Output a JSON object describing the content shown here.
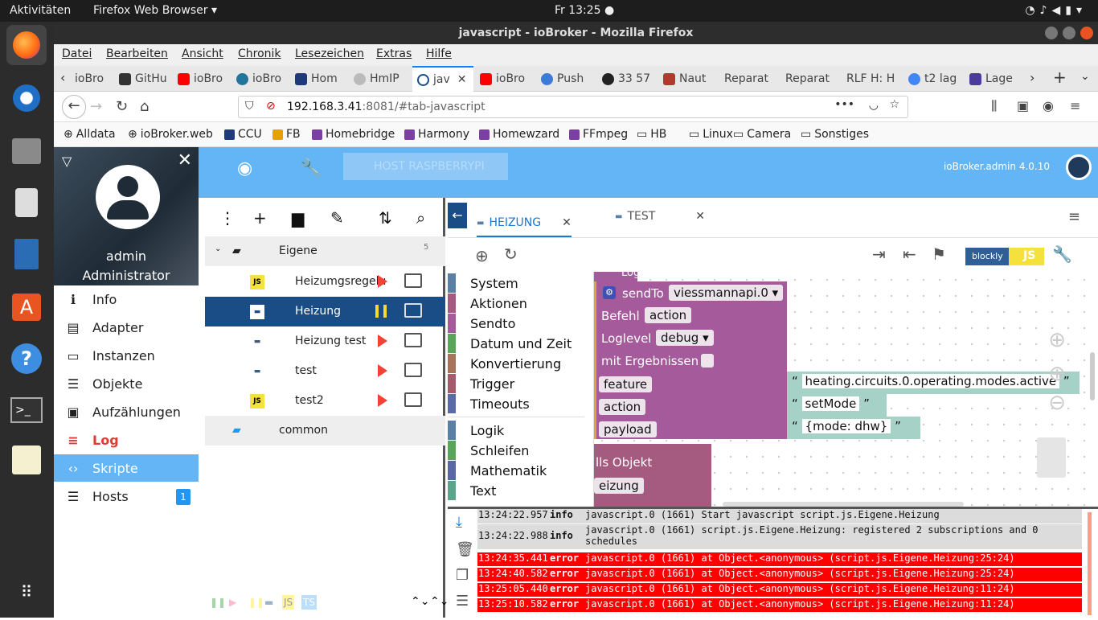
{
  "ubuntu": {
    "activities": "Aktivitäten",
    "app": "Firefox Web Browser ▾",
    "clock": "Fr 13:25 ●"
  },
  "window": {
    "title": "javascript - ioBroker - Mozilla Firefox"
  },
  "menu": [
    "Datei",
    "Bearbeiten",
    "Ansicht",
    "Chronik",
    "Lesezeichen",
    "Extras",
    "Hilfe"
  ],
  "tabs": [
    {
      "label": "ioBro",
      "color": "#4a8fd8"
    },
    {
      "label": "GitHu",
      "color": "#333333"
    },
    {
      "label": "ioBro",
      "color": "#ff0000"
    },
    {
      "label": "ioBro",
      "color": "#21759b"
    },
    {
      "label": "Hom",
      "color": "#1e3a78"
    },
    {
      "label": "HmIP",
      "color": "#bbbbbb"
    },
    {
      "label": "jav",
      "color": "#1a4d85"
    },
    {
      "label": "ioBro",
      "color": "#ff0000"
    },
    {
      "label": "Push",
      "color": "#3d7bd9"
    },
    {
      "label": "33 57",
      "color": "#222222"
    },
    {
      "label": "Naut",
      "color": "#b03a2e"
    },
    {
      "label": "Reparat",
      "color": "#dddddd"
    },
    {
      "label": "Reparat",
      "color": "#dddddd"
    },
    {
      "label": "RLF H: H",
      "color": "#dddddd"
    },
    {
      "label": "t2 lag",
      "color": "#4285f4"
    },
    {
      "label": "Lage",
      "color": "#4b3b9a"
    }
  ],
  "url": {
    "host": "192.168.3.41",
    "path": ":8081/#tab-javascript"
  },
  "bookmarks": [
    "Alldata",
    "ioBroker.web",
    "CCU",
    "FB",
    "Homebridge",
    "Harmony",
    "Homewzard",
    "FFmpeg",
    "HB",
    "Linux",
    "Camera",
    "Sonstiges"
  ],
  "profile": {
    "name": "admin",
    "role": "Administrator"
  },
  "nav": [
    {
      "label": "Info",
      "icon": "info-icon",
      "glyph": "ℹ"
    },
    {
      "label": "Adapter",
      "icon": "store-icon",
      "glyph": "▤"
    },
    {
      "label": "Instanzen",
      "icon": "instances-icon",
      "glyph": "▭"
    },
    {
      "label": "Objekte",
      "icon": "list-icon",
      "glyph": "☰"
    },
    {
      "label": "Aufzählungen",
      "icon": "enum-icon",
      "glyph": "▣"
    },
    {
      "label": "Log",
      "icon": "log-icon",
      "glyph": "≡"
    },
    {
      "label": "Skripte",
      "icon": "code-icon",
      "glyph": "‹›"
    },
    {
      "label": "Hosts",
      "icon": "hosts-icon",
      "glyph": "☰",
      "badge": "1"
    }
  ],
  "header": {
    "host": "HOST RASPBERRYPI",
    "version": "ioBroker.admin 4.0.10"
  },
  "tree": {
    "folder": "Eigene",
    "folder_count": "5",
    "scripts": [
      {
        "name": "Heizumgsregelu",
        "type": "JS",
        "running": false
      },
      {
        "name": "Heizung",
        "type": "blockly",
        "running": true
      },
      {
        "name": "Heizung test",
        "type": "blockly",
        "running": false
      },
      {
        "name": "test",
        "type": "blockly",
        "running": false
      },
      {
        "name": "test2",
        "type": "JS",
        "running": false
      }
    ],
    "common": "common"
  },
  "editor_tabs": [
    {
      "label": "HEIZUNG"
    },
    {
      "label": "TEST"
    }
  ],
  "mode": {
    "blockly": "blockly",
    "js": "JS"
  },
  "toolbox": {
    "group1": [
      "System",
      "Aktionen",
      "Sendto",
      "Datum und Zeit",
      "Konvertierung",
      "Trigger",
      "Timeouts"
    ],
    "group2": [
      "Logik",
      "Schleifen",
      "Mathematik",
      "Text"
    ],
    "colors": [
      "#5b80a5",
      "#a55b80",
      "#a55b9b",
      "#5ba55b",
      "#a5745b",
      "#a55b6b",
      "#5b6ba5",
      "#5b80a5",
      "#5ba55b",
      "#5b67a5",
      "#5ba58c"
    ]
  },
  "blocks": {
    "top_cut": "Loglevel  keins ▾",
    "sendto": "sendTo",
    "instance": "viessmannapi.0 ▾",
    "befehl": "Befehl",
    "action_val": "action",
    "loglevel": "Loglevel",
    "loglevel_val": "debug ▾",
    "mit": "mit Ergebnissen",
    "params": [
      {
        "key": "feature",
        "value": "heating.circuits.0.operating.modes.active"
      },
      {
        "key": "action",
        "value": "setMode"
      },
      {
        "key": "payload",
        "value": "{mode: dhw}"
      }
    ],
    "lower1": "lls Objekt",
    "lower2": "eizung"
  },
  "log": [
    {
      "time": "13:24:22.957",
      "sev": "info",
      "msg": "javascript.0 (1661) Start javascript script.js.Eigene.Heizung"
    },
    {
      "time": "13:24:22.988",
      "sev": "info",
      "msg": "javascript.0 (1661) script.js.Eigene.Heizung: registered 2 subscriptions and 0 schedules"
    },
    {
      "time": "13:24:35.441",
      "sev": "error",
      "msg": "javascript.0 (1661) at Object.<anonymous> (script.js.Eigene.Heizung:25:24)"
    },
    {
      "time": "13:24:40.582",
      "sev": "error",
      "msg": "javascript.0 (1661) at Object.<anonymous> (script.js.Eigene.Heizung:25:24)"
    },
    {
      "time": "13:25:05.440",
      "sev": "error",
      "msg": "javascript.0 (1661) at Object.<anonymous> (script.js.Eigene.Heizung:11:24)"
    },
    {
      "time": "13:25:10.582",
      "sev": "error",
      "msg": "javascript.0 (1661) at Object.<anonymous> (script.js.Eigene.Heizung:11:24)"
    }
  ]
}
